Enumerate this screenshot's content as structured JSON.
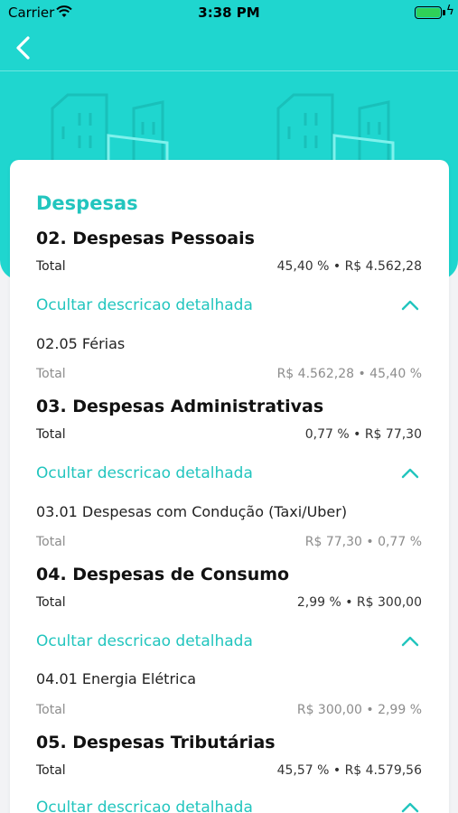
{
  "status_bar": {
    "carrier": "Carrier",
    "time": "3:38 PM"
  },
  "colors": {
    "accent": "#1fd6cf",
    "accent_text": "#22c5be",
    "background": "#f2f3f5"
  },
  "header": {
    "back_icon": "chevron-left-icon"
  },
  "card": {
    "title": "Despesas",
    "sections": [
      {
        "title": "02. Despesas Pessoais",
        "total_label": "Total",
        "total_value": "45,40 % • R$ 4.562,28",
        "toggle_label": "Ocultar descricao detalhada",
        "item": {
          "name": "02.05 Férias",
          "total_label": "Total",
          "total_value": "R$ 4.562,28 • 45,40 %"
        }
      },
      {
        "title": "03. Despesas Administrativas",
        "total_label": "Total",
        "total_value": "0,77 % • R$ 77,30",
        "toggle_label": "Ocultar descricao detalhada",
        "item": {
          "name": "03.01 Despesas com Condução (Taxi/Uber)",
          "total_label": "Total",
          "total_value": "R$ 77,30 • 0,77 %"
        }
      },
      {
        "title": "04. Despesas de Consumo",
        "total_label": "Total",
        "total_value": "2,99 % • R$ 300,00",
        "toggle_label": "Ocultar descricao detalhada",
        "item": {
          "name": "04.01 Energia Elétrica",
          "total_label": "Total",
          "total_value": "R$ 300,00 • 2,99 %"
        }
      },
      {
        "title": "05. Despesas Tributárias",
        "total_label": "Total",
        "total_value": "45,57 % • R$ 4.579,56",
        "toggle_label": "Ocultar descricao detalhada"
      }
    ]
  }
}
